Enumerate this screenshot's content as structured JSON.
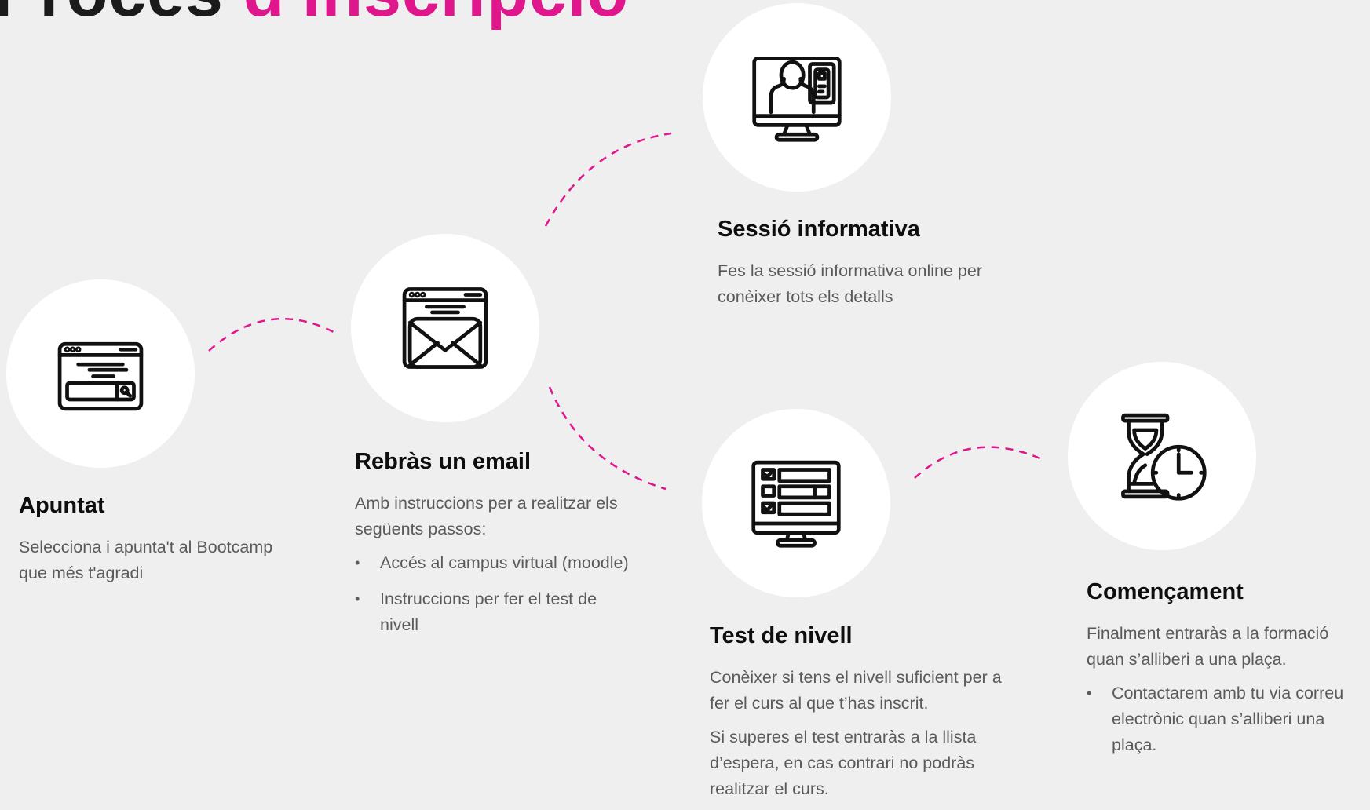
{
  "header": {
    "title_part1": "Procés",
    "title_part2": "d'inscripció"
  },
  "colors": {
    "accent": "#e0168c",
    "background": "#efefef"
  },
  "steps": [
    {
      "icon": "browser-search-icon",
      "title": "Apuntat",
      "paragraphs": [
        "Selecciona i apunta't al Bootcamp que més t'agradi"
      ],
      "bullets": []
    },
    {
      "icon": "browser-envelope-icon",
      "title": "Rebràs un email",
      "paragraphs": [
        "Amb instruccions per a realitzar els següents passos:"
      ],
      "bullets": [
        "Accés al campus virtual (moodle)",
        "Instruccions per fer el test de nivell"
      ]
    },
    {
      "icon": "monitor-video-call-icon",
      "title": "Sessió informativa",
      "paragraphs": [
        "Fes la sessió informativa online per conèixer tots els detalls"
      ],
      "bullets": []
    },
    {
      "icon": "monitor-checklist-icon",
      "title": "Test de nivell",
      "paragraphs": [
        "Conèixer si tens el nivell suficient per a fer el curs al que t’has inscrit.",
        "Si superes el test entraràs a la llista d’espera, en cas contrari no podràs realitzar el curs."
      ],
      "bullets": []
    },
    {
      "icon": "hourglass-clock-icon",
      "title": "Començament",
      "paragraphs": [
        "Finalment entraràs a la formació quan s’alliberi a una plaça."
      ],
      "bullets": [
        "Contactarem amb tu via correu electrònic quan s’alliberi una plaça."
      ]
    }
  ]
}
